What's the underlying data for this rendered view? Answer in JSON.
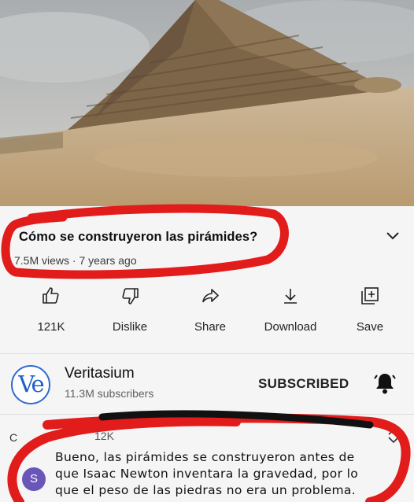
{
  "video": {
    "title": "Cómo se construyeron las pirámides?",
    "meta": "7.5M views · 7 years ago"
  },
  "actions": [
    {
      "label": "121K",
      "icon": "thumbs-up-icon"
    },
    {
      "label": "Dislike",
      "icon": "thumbs-down-icon"
    },
    {
      "label": "Share",
      "icon": "share-icon"
    },
    {
      "label": "Download",
      "icon": "download-icon"
    },
    {
      "label": "Save",
      "icon": "save-icon"
    }
  ],
  "channel": {
    "logo_text": "Ve",
    "name": "Veritasium",
    "subscribers": "11.3M subscribers",
    "subscribe_label": "SUBSCRIBED"
  },
  "comments": {
    "header": "C",
    "count": "12K",
    "avatar_letter": "S",
    "text": "Bueno, las pirámides se construyeron antes de que Isaac Newton inventara la gravedad, por lo que el peso de las piedras no era un problema."
  },
  "colors": {
    "accent": "#1f5fc9",
    "marker": "#e21b1b",
    "avatar": "#6a55b8"
  }
}
